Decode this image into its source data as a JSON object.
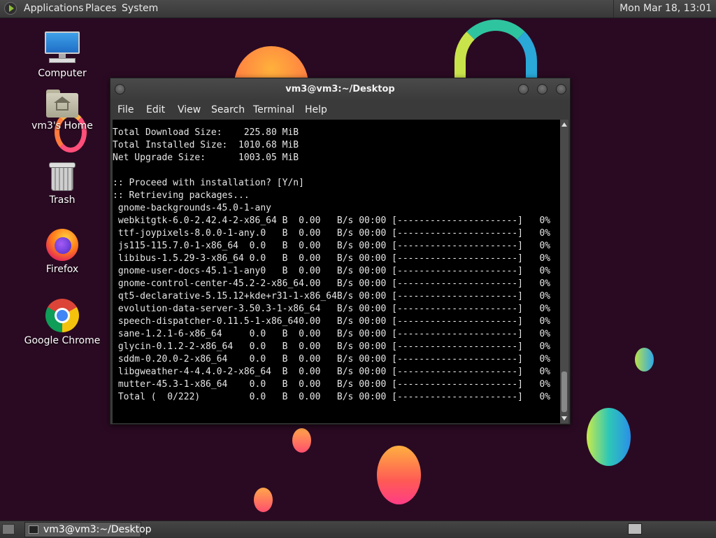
{
  "top_panel": {
    "applications_label": "Applications",
    "places_label": "Places",
    "system_label": "System",
    "clock": "Mon Mar 18, 13:01"
  },
  "desktop_icons": [
    {
      "label": "Computer",
      "icon": "computer-icon"
    },
    {
      "label": "vm3's Home",
      "icon": "home-folder-icon"
    },
    {
      "label": "Trash",
      "icon": "trash-icon"
    },
    {
      "label": "Firefox",
      "icon": "firefox-icon"
    },
    {
      "label": "Google Chrome",
      "icon": "chrome-icon"
    }
  ],
  "terminal": {
    "title": "vm3@vm3:~/Desktop",
    "menu": [
      "File",
      "Edit",
      "View",
      "Search",
      "Terminal",
      "Help"
    ],
    "lines": [
      "Total Download Size:    225.80 MiB",
      "Total Installed Size:  1010.68 MiB",
      "Net Upgrade Size:      1003.05 MiB",
      "",
      ":: Proceed with installation? [Y/n]",
      ":: Retrieving packages...",
      " gnome-backgrounds-45.0-1-any",
      " webkitgtk-6.0-2.42.4-2-x86_64 B  0.00   B/s 00:00 [----------------------]   0%",
      " ttf-joypixels-8.0.0-1-any.0   B  0.00   B/s 00:00 [----------------------]   0%",
      " js115-115.7.0-1-x86_64  0.0   B  0.00   B/s 00:00 [----------------------]   0%",
      " libibus-1.5.29-3-x86_64 0.0   B  0.00   B/s 00:00 [----------------------]   0%",
      " gnome-user-docs-45.1-1-any0   B  0.00   B/s 00:00 [----------------------]   0%",
      " gnome-control-center-45.2-2-x86_64.00   B/s 00:00 [----------------------]   0%",
      " qt5-declarative-5.15.12+kde+r31-1-x86_64B/s 00:00 [----------------------]   0%",
      " evolution-data-server-3.50.3-1-x86_64   B/s 00:00 [----------------------]   0%",
      " speech-dispatcher-0.11.5-1-x86_640.00   B/s 00:00 [----------------------]   0%",
      " sane-1.2.1-6-x86_64     0.0   B  0.00   B/s 00:00 [----------------------]   0%",
      " glycin-0.1.2-2-x86_64   0.0   B  0.00   B/s 00:00 [----------------------]   0%",
      " sddm-0.20.0-2-x86_64    0.0   B  0.00   B/s 00:00 [----------------------]   0%",
      " libgweather-4-4.4.0-2-x86_64  B  0.00   B/s 00:00 [----------------------]   0%",
      " mutter-45.3-1-x86_64    0.0   B  0.00   B/s 00:00 [----------------------]   0%",
      " Total (  0/222)         0.0   B  0.00   B/s 00:00 [----------------------]   0%"
    ]
  },
  "taskbar": {
    "task_label": "vm3@vm3:~/Desktop"
  }
}
